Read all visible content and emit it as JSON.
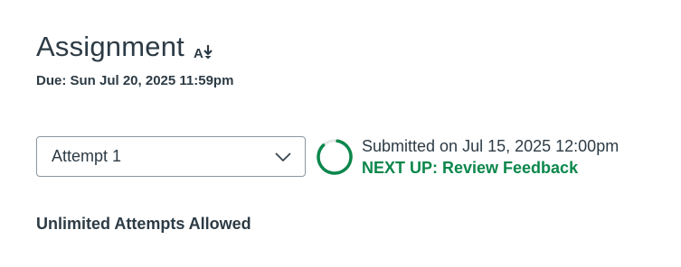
{
  "header": {
    "title": "Assignment",
    "due": "Due: Sun Jul 20, 2025 11:59pm",
    "icon": "text-direction-icon"
  },
  "attempt_select": {
    "selected": "Attempt 1",
    "icon": "chevron-down-icon"
  },
  "status": {
    "submitted_text": "Submitted on Jul 15, 2025 12:00pm",
    "next_up": "NEXT UP: Review Feedback",
    "progress_fraction": 0.85,
    "accent_color": "#0b874b"
  },
  "attempts_info": "Unlimited Attempts Allowed"
}
